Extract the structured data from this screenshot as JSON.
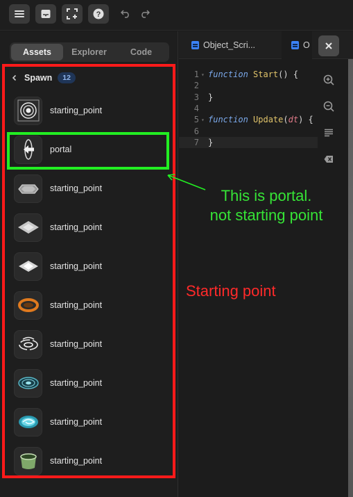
{
  "toolbar": {
    "buttons": [
      "menu-icon",
      "inbox-icon",
      "add-frame-icon",
      "help-icon",
      "undo-icon",
      "redo-icon"
    ]
  },
  "left_panel": {
    "tabs": [
      {
        "label": "Assets",
        "active": true
      },
      {
        "label": "Explorer",
        "active": false
      },
      {
        "label": "Code",
        "active": false
      }
    ],
    "folder": {
      "title": "Spawn",
      "count": "12"
    },
    "assets": [
      {
        "name": "starting_point",
        "icon": "target-rings-icon"
      },
      {
        "name": "portal",
        "icon": "portal-arrow-icon"
      },
      {
        "name": "starting_point",
        "icon": "hexagon-pad-icon"
      },
      {
        "name": "starting_point",
        "icon": "diamond-pad-icon"
      },
      {
        "name": "starting_point",
        "icon": "diamond-pad-light-icon"
      },
      {
        "name": "starting_point",
        "icon": "orange-ring-icon"
      },
      {
        "name": "starting_point",
        "icon": "orbit-rings-icon"
      },
      {
        "name": "starting_point",
        "icon": "teal-disc-icon"
      },
      {
        "name": "starting_point",
        "icon": "cyan-swirl-icon"
      },
      {
        "name": "starting_point",
        "icon": "green-cup-icon"
      }
    ]
  },
  "annotations": {
    "green_note_line1": "This is portal.",
    "green_note_line2": "not starting point",
    "red_note": "Starting point",
    "green_color": "#22ee22",
    "red_color": "#ff1a1a"
  },
  "editor": {
    "tabs": [
      {
        "label": "Object_Scri..."
      },
      {
        "label": "O"
      }
    ],
    "lines": [
      {
        "n": "1",
        "kw": "function",
        "fn": "Start",
        "pm": "",
        "rest": "() {"
      },
      {
        "n": "2",
        "kw": "",
        "fn": "",
        "pm": "",
        "rest": ""
      },
      {
        "n": "3",
        "kw": "",
        "fn": "",
        "pm": "",
        "rest": "}"
      },
      {
        "n": "4",
        "kw": "",
        "fn": "",
        "pm": "",
        "rest": ""
      },
      {
        "n": "5",
        "kw": "function",
        "fn": "Update",
        "pm": "dt",
        "rest": ") {"
      },
      {
        "n": "6",
        "kw": "",
        "fn": "",
        "pm": "",
        "rest": ""
      },
      {
        "n": "7",
        "kw": "",
        "fn": "",
        "pm": "",
        "rest": "}"
      }
    ],
    "tools": [
      "zoom-in-icon",
      "zoom-out-icon",
      "format-icon",
      "clear-icon"
    ]
  }
}
